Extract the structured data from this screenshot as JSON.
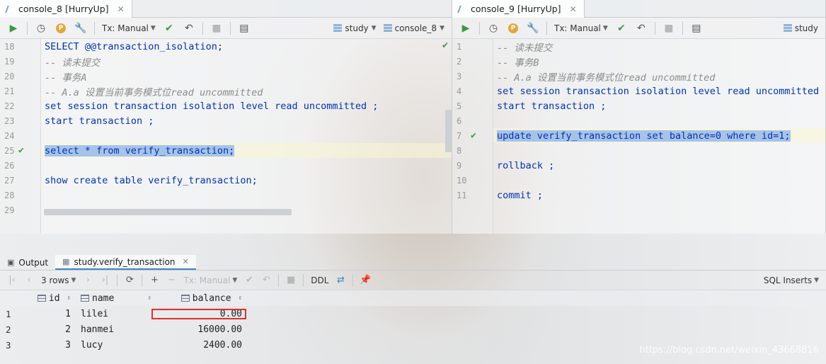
{
  "left_pane": {
    "tab_label": "console_8 [HurryUp]",
    "tx_mode": "Tx: Manual",
    "schema": "study",
    "console": "console_8",
    "lines": [
      {
        "n": "18",
        "text": "SELECT @@transaction_isolation;"
      },
      {
        "n": "19",
        "text": "-- 读未提交"
      },
      {
        "n": "20",
        "text": "-- 事务A"
      },
      {
        "n": "21",
        "text": "-- A.a 设置当前事务模式位read uncommitted"
      },
      {
        "n": "22",
        "text": "set session transaction isolation level read uncommitted ;"
      },
      {
        "n": "23",
        "text": "start transaction ;"
      },
      {
        "n": "24",
        "text": ""
      },
      {
        "n": "25",
        "text": "select * from verify_transaction;"
      },
      {
        "n": "26",
        "text": ""
      },
      {
        "n": "27",
        "text": "show create table verify_transaction;"
      },
      {
        "n": "28",
        "text": ""
      },
      {
        "n": "29",
        "text": ""
      }
    ]
  },
  "right_pane": {
    "tab_label": "console_9 [HurryUp]",
    "tx_mode": "Tx: Manual",
    "schema": "study",
    "lines": [
      {
        "n": "1",
        "text": "-- 读未提交"
      },
      {
        "n": "2",
        "text": "-- 事务B"
      },
      {
        "n": "3",
        "text": "-- A.a 设置当前事务模式位read uncommitted"
      },
      {
        "n": "4",
        "text": "set session transaction isolation level read uncommitted ;"
      },
      {
        "n": "5",
        "text": "start transaction ;"
      },
      {
        "n": "6",
        "text": ""
      },
      {
        "n": "7",
        "text": "update verify_transaction set balance=0 where id=1;"
      },
      {
        "n": "8",
        "text": ""
      },
      {
        "n": "9",
        "text": "rollback ;"
      },
      {
        "n": "10",
        "text": ""
      },
      {
        "n": "11",
        "text": "commit ;"
      }
    ]
  },
  "results": {
    "tabs": [
      "Output",
      "study.verify_transaction"
    ],
    "rows_label": "3 rows",
    "tx_mode": "Tx: Manual",
    "ddl_label": "DDL",
    "export_label": "SQL Inserts",
    "columns": [
      "id",
      "name",
      "balance"
    ],
    "rows": [
      {
        "row": "1",
        "id": "1",
        "name": "lilei",
        "balance": "0.00"
      },
      {
        "row": "2",
        "id": "2",
        "name": "hanmei",
        "balance": "16000.00"
      },
      {
        "row": "3",
        "id": "3",
        "name": "lucy",
        "balance": "2400.00"
      }
    ]
  },
  "watermark": "https://blog.csdn.net/weixin_43668816"
}
